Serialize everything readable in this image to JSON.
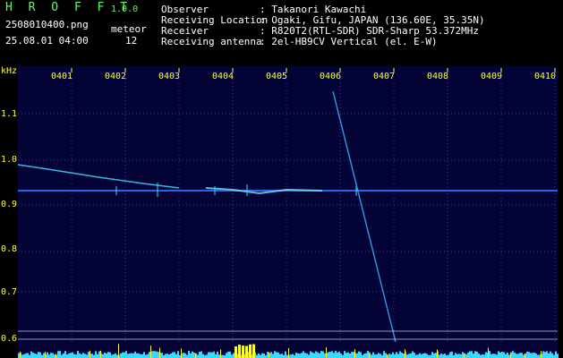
{
  "header": {
    "app_name": "H R O F F T",
    "version": "1.0.0",
    "filename": "2508010400.png",
    "datetime": "25.08.01 04:00",
    "detection_label": "meteor",
    "detection_count": "12",
    "info": [
      {
        "label": "Observer",
        "value": ": Takanori Kawachi"
      },
      {
        "label": "Receiving Location",
        "value": ": Ogaki, Gifu, JAPAN (136.60E, 35.35N)"
      },
      {
        "label": "Receiver",
        "value": ": R820T2(RTL-SDR) SDR-Sharp 53.372MHz"
      },
      {
        "label": "Receiving antenna",
        "value": ": 2el-HB9CV Vertical (el. E-W)"
      }
    ]
  },
  "spectrogram": {
    "y_unit": "kHz",
    "y_ticks": [
      "1.1",
      "1.0",
      "0.9",
      "0.8",
      "0.7",
      "0.6"
    ],
    "time_labels": [
      "0401",
      "0402",
      "0403",
      "0404",
      "0405",
      "0406",
      "0407",
      "0408",
      "0409",
      "0410"
    ],
    "colors": {
      "background": "#030335",
      "signal": "#3ad9ff",
      "grid": "#3a3a8a",
      "text": "#ffff33",
      "peak": "#ffff33"
    }
  }
}
